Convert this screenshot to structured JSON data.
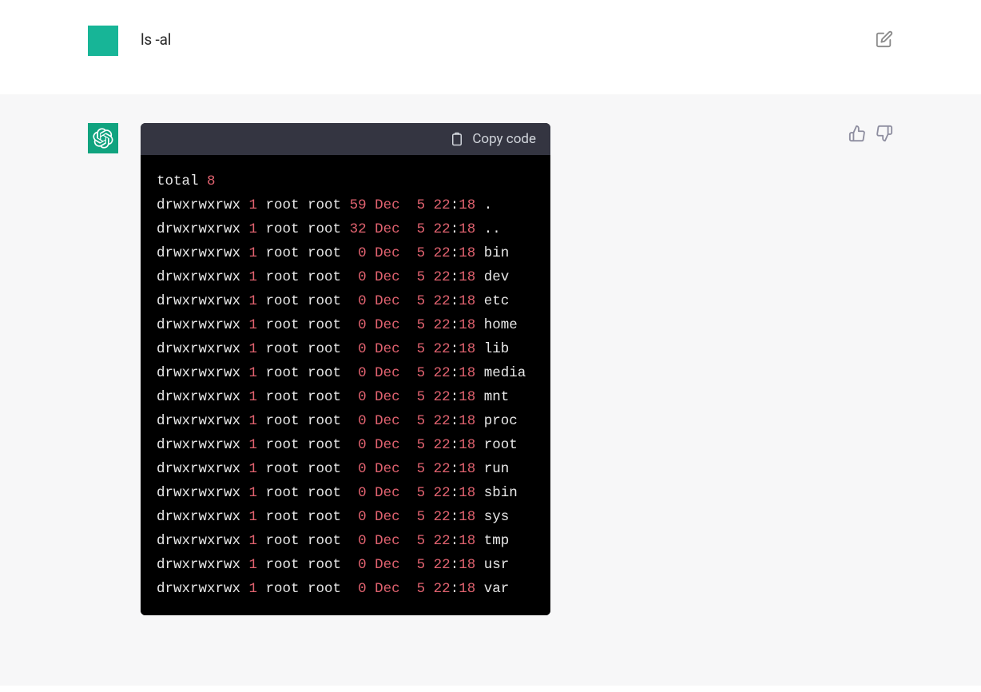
{
  "user": {
    "message": "ls -al"
  },
  "assistant": {
    "code_header": {
      "copy_label": "Copy code"
    },
    "total_label": "total",
    "total_value": "8",
    "rows": [
      {
        "perm": "drwxrwxrwx",
        "link": "1",
        "owner": "root",
        "group": "root",
        "size": "59",
        "month": "Dec",
        "day": "5",
        "hh": "22",
        "mm": "18",
        "name": "."
      },
      {
        "perm": "drwxrwxrwx",
        "link": "1",
        "owner": "root",
        "group": "root",
        "size": "32",
        "month": "Dec",
        "day": "5",
        "hh": "22",
        "mm": "18",
        "name": ".."
      },
      {
        "perm": "drwxrwxrwx",
        "link": "1",
        "owner": "root",
        "group": "root",
        "size": "0",
        "month": "Dec",
        "day": "5",
        "hh": "22",
        "mm": "18",
        "name": "bin"
      },
      {
        "perm": "drwxrwxrwx",
        "link": "1",
        "owner": "root",
        "group": "root",
        "size": "0",
        "month": "Dec",
        "day": "5",
        "hh": "22",
        "mm": "18",
        "name": "dev"
      },
      {
        "perm": "drwxrwxrwx",
        "link": "1",
        "owner": "root",
        "group": "root",
        "size": "0",
        "month": "Dec",
        "day": "5",
        "hh": "22",
        "mm": "18",
        "name": "etc"
      },
      {
        "perm": "drwxrwxrwx",
        "link": "1",
        "owner": "root",
        "group": "root",
        "size": "0",
        "month": "Dec",
        "day": "5",
        "hh": "22",
        "mm": "18",
        "name": "home"
      },
      {
        "perm": "drwxrwxrwx",
        "link": "1",
        "owner": "root",
        "group": "root",
        "size": "0",
        "month": "Dec",
        "day": "5",
        "hh": "22",
        "mm": "18",
        "name": "lib"
      },
      {
        "perm": "drwxrwxrwx",
        "link": "1",
        "owner": "root",
        "group": "root",
        "size": "0",
        "month": "Dec",
        "day": "5",
        "hh": "22",
        "mm": "18",
        "name": "media"
      },
      {
        "perm": "drwxrwxrwx",
        "link": "1",
        "owner": "root",
        "group": "root",
        "size": "0",
        "month": "Dec",
        "day": "5",
        "hh": "22",
        "mm": "18",
        "name": "mnt"
      },
      {
        "perm": "drwxrwxrwx",
        "link": "1",
        "owner": "root",
        "group": "root",
        "size": "0",
        "month": "Dec",
        "day": "5",
        "hh": "22",
        "mm": "18",
        "name": "proc"
      },
      {
        "perm": "drwxrwxrwx",
        "link": "1",
        "owner": "root",
        "group": "root",
        "size": "0",
        "month": "Dec",
        "day": "5",
        "hh": "22",
        "mm": "18",
        "name": "root"
      },
      {
        "perm": "drwxrwxrwx",
        "link": "1",
        "owner": "root",
        "group": "root",
        "size": "0",
        "month": "Dec",
        "day": "5",
        "hh": "22",
        "mm": "18",
        "name": "run"
      },
      {
        "perm": "drwxrwxrwx",
        "link": "1",
        "owner": "root",
        "group": "root",
        "size": "0",
        "month": "Dec",
        "day": "5",
        "hh": "22",
        "mm": "18",
        "name": "sbin"
      },
      {
        "perm": "drwxrwxrwx",
        "link": "1",
        "owner": "root",
        "group": "root",
        "size": "0",
        "month": "Dec",
        "day": "5",
        "hh": "22",
        "mm": "18",
        "name": "sys"
      },
      {
        "perm": "drwxrwxrwx",
        "link": "1",
        "owner": "root",
        "group": "root",
        "size": "0",
        "month": "Dec",
        "day": "5",
        "hh": "22",
        "mm": "18",
        "name": "tmp"
      },
      {
        "perm": "drwxrwxrwx",
        "link": "1",
        "owner": "root",
        "group": "root",
        "size": "0",
        "month": "Dec",
        "day": "5",
        "hh": "22",
        "mm": "18",
        "name": "usr"
      },
      {
        "perm": "drwxrwxrwx",
        "link": "1",
        "owner": "root",
        "group": "root",
        "size": "0",
        "month": "Dec",
        "day": "5",
        "hh": "22",
        "mm": "18",
        "name": "var"
      }
    ]
  }
}
